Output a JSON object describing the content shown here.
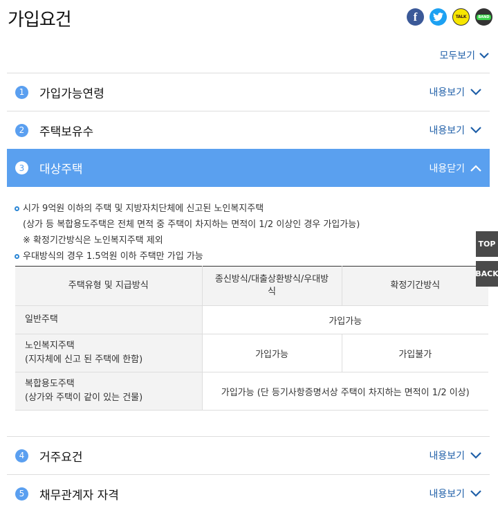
{
  "header": {
    "title": "가입요건"
  },
  "share": [
    {
      "icon": "facebook-icon",
      "glyph": "f"
    },
    {
      "icon": "twitter-icon",
      "glyph": ""
    },
    {
      "icon": "kakaotalk-icon",
      "glyph": "TALK"
    },
    {
      "icon": "band-icon",
      "glyph": "BAND"
    }
  ],
  "view_all": {
    "label": "모두보기"
  },
  "sections": [
    {
      "num": "1",
      "title": "가입가능연령",
      "toggle": "내용보기"
    },
    {
      "num": "2",
      "title": "주택보유수",
      "toggle": "내용보기"
    },
    {
      "num": "3",
      "title": "대상주택",
      "toggle": "내용닫기"
    },
    {
      "num": "4",
      "title": "거주요건",
      "toggle": "내용보기"
    },
    {
      "num": "5",
      "title": "채무관계자 자격",
      "toggle": "내용보기"
    }
  ],
  "content": {
    "bullet1": "시가 9억원 이하의 주택 및 지방자치단체에 신고된 노인복지주택",
    "bullet1_note1": "(상가 등 복합용도주택은 전체 면적 중 주택이 차지하는 면적이 1/2 이상인 경우 가입가능)",
    "bullet1_note2": "※ 확정기간방식은 노인복지주택 제외",
    "bullet2": "우대방식의 경우 1.5억원 이하 주택만 가입 가능"
  },
  "table": {
    "headers": [
      "주택유형 및 지급방식",
      "종신방식/대출상환방식/우대방식",
      "확정기간방식"
    ],
    "rows": [
      {
        "type": "일반주택",
        "merged": "가입가능"
      },
      {
        "type": "노인복지주택",
        "type_sub": "(지자체에 신고 된 주택에 한함)",
        "col1": "가입가능",
        "col2": "가입불가"
      },
      {
        "type": "복합용도주택",
        "type_sub": "(상가와 주택이 같이 있는 건물)",
        "merged": "가입가능 (단 등기사항증명서상 주택이 차지하는 면적이 1/2 이상)"
      }
    ]
  },
  "side": {
    "top": "TOP",
    "back": "BACK"
  },
  "colors": {
    "accent": "#5aa0ef",
    "link": "#1f5fa8",
    "bullet": "#2a86d5"
  }
}
